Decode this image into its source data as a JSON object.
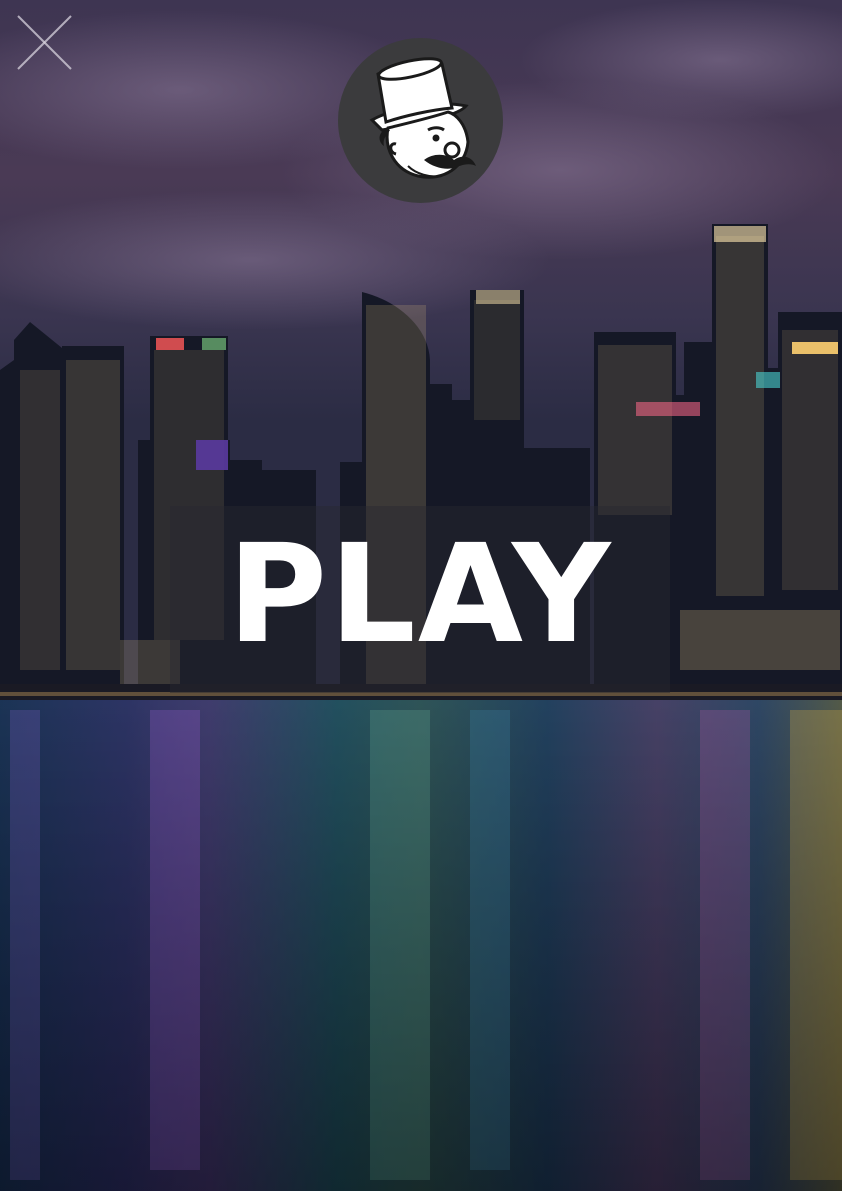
{
  "play_button": {
    "label": "PLAY"
  },
  "close_button": {
    "icon": "close-icon"
  },
  "logo": {
    "icon": "top-hat-mascot-icon"
  },
  "colors": {
    "sky_top": "#3b3a55",
    "sky_bottom": "#5a4460",
    "water": "#10304a",
    "logo_bg": "#3b3b3d",
    "text": "#ffffff"
  }
}
